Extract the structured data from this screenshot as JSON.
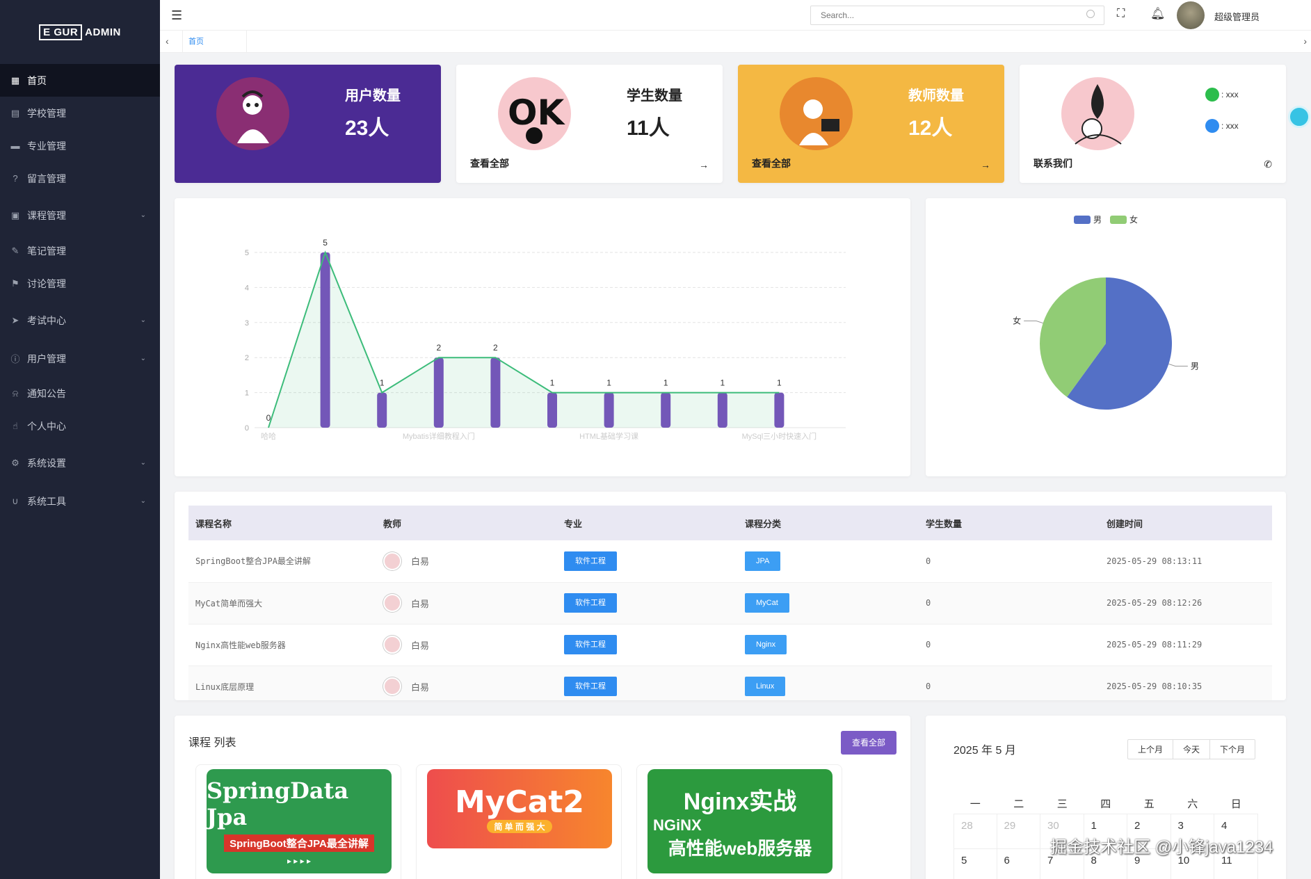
{
  "sidebar": {
    "logo": {
      "box": "E GUR",
      "text": "ADMIN"
    },
    "items": [
      {
        "label": "首页",
        "icon": "grid-icon",
        "active": true,
        "expandable": false
      },
      {
        "label": "学校管理",
        "icon": "building-icon",
        "expandable": false
      },
      {
        "label": "专业管理",
        "icon": "monitor-icon",
        "expandable": false
      },
      {
        "label": "留言管理",
        "icon": "question-icon",
        "expandable": false
      },
      {
        "label": "课程管理",
        "icon": "book-icon",
        "expandable": true
      },
      {
        "label": "笔记管理",
        "icon": "edit-icon",
        "expandable": false
      },
      {
        "label": "讨论管理",
        "icon": "flag-icon",
        "expandable": false
      },
      {
        "label": "考试中心",
        "icon": "send-icon",
        "expandable": true
      },
      {
        "label": "用户管理",
        "icon": "info-icon",
        "expandable": true
      },
      {
        "label": "通知公告",
        "icon": "bell-icon",
        "expandable": false
      },
      {
        "label": "个人中心",
        "icon": "thumb-icon",
        "expandable": false
      },
      {
        "label": "系统设置",
        "icon": "gear-icon",
        "expandable": true
      },
      {
        "label": "系统工具",
        "icon": "magnet-icon",
        "expandable": true
      }
    ]
  },
  "header": {
    "search_placeholder": "Search...",
    "username": "超级管理员"
  },
  "tabs": {
    "home": "首页"
  },
  "stats": [
    {
      "title": "用户数量",
      "value": "23人",
      "link": ""
    },
    {
      "title": "学生数量",
      "value": "11人",
      "link": "查看全部"
    },
    {
      "title": "教师数量",
      "value": "12人",
      "link": "查看全部"
    },
    {
      "title": "",
      "value": "",
      "link": "联系我们"
    }
  ],
  "contact": [
    {
      "icon": "wechat-icon",
      "text": ": xxx",
      "color": "#2cbd4c"
    },
    {
      "icon": "qq-icon",
      "text": ": xxx",
      "color": "#2f8cf0"
    }
  ],
  "colors": {
    "purple": "#4b2b94",
    "orange": "#f4b843",
    "tag_blue": "#2f8cf0",
    "bar": "#7357b8",
    "line": "#3cbc7a",
    "pie_male": "#5470c6",
    "pie_female": "#91cc75",
    "button_purple": "#7b5bc6"
  },
  "chart_data": [
    {
      "type": "bar",
      "categories": [
        "哈哈",
        "",
        "",
        "Mybatis详细教程入门",
        "",
        "",
        "HTML基础学习课",
        "",
        "",
        "MySql三小时快速入门"
      ],
      "x_tick_labels": [
        "哈哈",
        "Mybatis详细教程入门",
        "HTML基础学习课",
        "MySql三小时快速入门"
      ],
      "series": [
        {
          "type": "bar",
          "values": [
            0,
            5,
            1,
            2,
            2,
            1,
            1,
            1,
            1,
            1
          ]
        },
        {
          "type": "line-area",
          "values": [
            0,
            5,
            1,
            2,
            2,
            1,
            1,
            1,
            1,
            1
          ]
        }
      ],
      "ylim": [
        0,
        5
      ],
      "yticks": [
        0,
        1,
        2,
        3,
        4,
        5
      ],
      "grid": true
    },
    {
      "type": "pie",
      "legend": [
        "男",
        "女"
      ],
      "slices": [
        {
          "label": "男",
          "value": 12
        },
        {
          "label": "女",
          "value": 8
        }
      ],
      "legend_position": "top-center"
    }
  ],
  "table": {
    "headers": [
      "课程名称",
      "教师",
      "专业",
      "课程分类",
      "学生数量",
      "创建时间"
    ],
    "rows": [
      {
        "name": "SpringBoot整合JPA最全讲解",
        "teacher": "白易",
        "major": "软件工程",
        "category": "JPA",
        "students": "0",
        "created": "2025-05-29 08:13:11"
      },
      {
        "name": "MyCat简单而强大",
        "teacher": "白易",
        "major": "软件工程",
        "category": "MyCat",
        "students": "0",
        "created": "2025-05-29 08:12:26"
      },
      {
        "name": "Nginx高性能web服务器",
        "teacher": "白易",
        "major": "软件工程",
        "category": "Nginx",
        "students": "0",
        "created": "2025-05-29 08:11:29"
      },
      {
        "name": "Linux底层原理",
        "teacher": "白易",
        "major": "软件工程",
        "category": "Linux",
        "students": "0",
        "created": "2025-05-29 08:10:35"
      }
    ]
  },
  "courses": {
    "title": "课程 列表",
    "view_all": "查看全部",
    "items": [
      {
        "line1": "SpringData Jpa",
        "line2": "SpringBoot整合JPA最全讲解",
        "line3": "▸ ▸ ▸ ▸",
        "bg": "#2e9a4e"
      },
      {
        "line1": "MyCat2",
        "line2": "简 单 而 强 大",
        "line3": "",
        "bg": "#ef5e3b"
      },
      {
        "line1": "Nginx实战",
        "line2": "NGiNX",
        "line3": "高性能web服务器",
        "bg": "#2c9a3e"
      }
    ]
  },
  "calendar": {
    "title": "2025 年 5 月",
    "buttons": [
      "上个月",
      "今天",
      "下个月"
    ],
    "weekdays": [
      "一",
      "二",
      "三",
      "四",
      "五",
      "六",
      "日"
    ],
    "week1": [
      "28",
      "29",
      "30",
      "1",
      "2",
      "3",
      "4"
    ],
    "week2": [
      "5",
      "6",
      "7",
      "8",
      "9",
      "10",
      "11"
    ]
  },
  "watermark": "掘金技术社区 @小锋java1234"
}
